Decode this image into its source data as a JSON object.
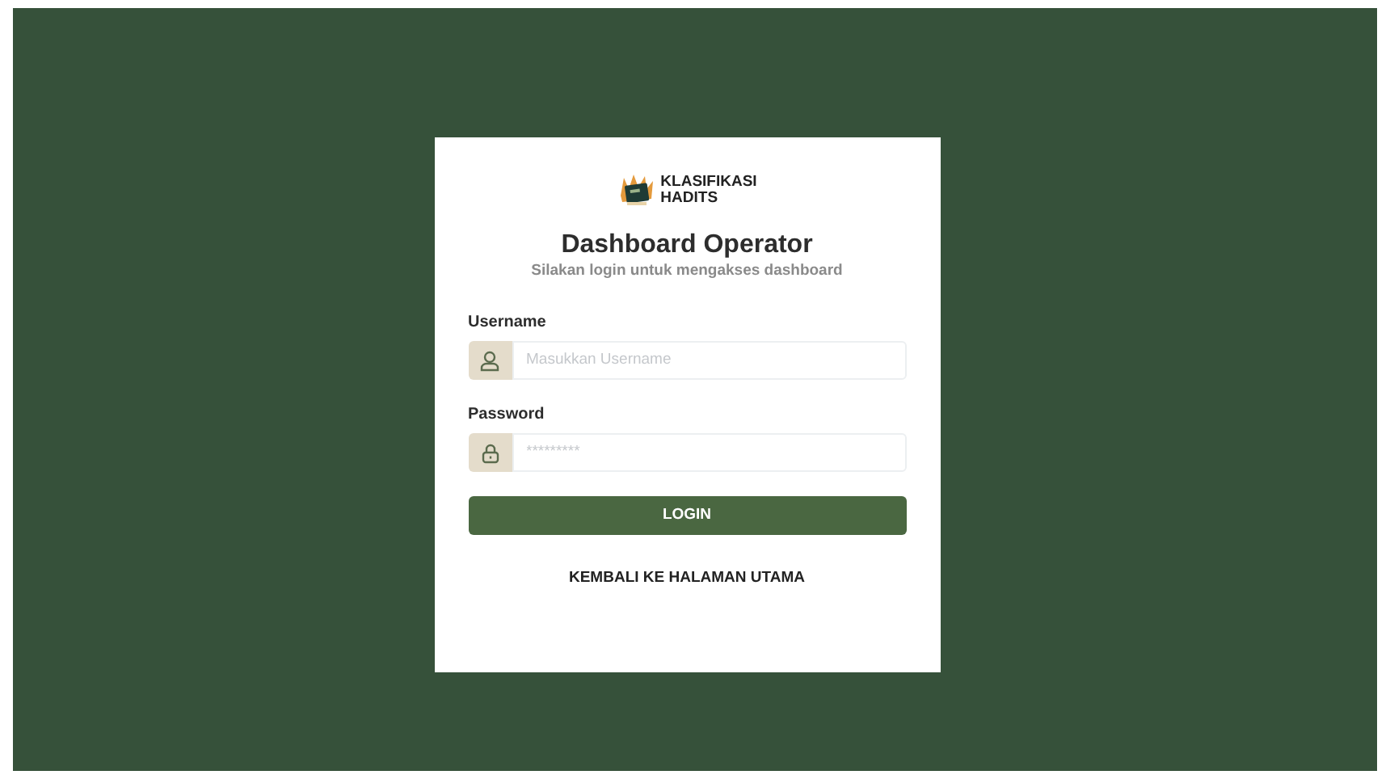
{
  "logo": {
    "line_1": "KLASIFIKASI",
    "line_2": "HADITS"
  },
  "title": "Dashboard Operator",
  "subtitle": "Silakan login untuk mengakses dashboard",
  "fields": [
    {
      "label": "Username",
      "placeholder": "Masukkan Username",
      "kind": "user"
    },
    {
      "label": "Password",
      "placeholder": "*********",
      "kind": "lock"
    }
  ],
  "login_button": "LOGIN",
  "back_link": "KEMBALI KE HALAMAN UTAMA"
}
